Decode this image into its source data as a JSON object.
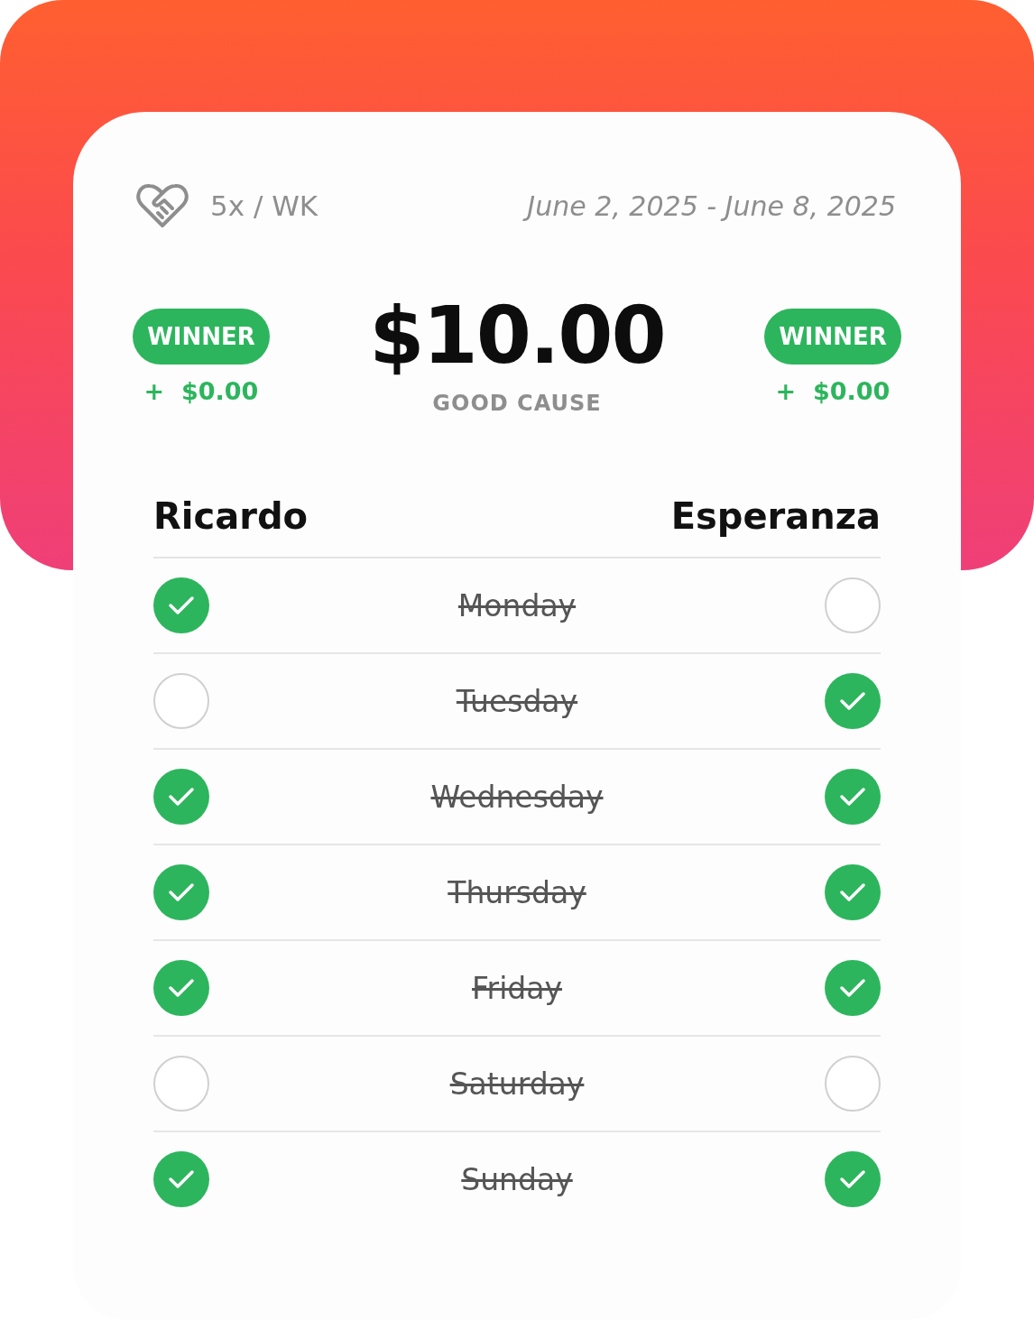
{
  "header": {
    "frequency": "5x / WK",
    "date_range": "June 2, 2025 - June 8, 2025"
  },
  "pot": {
    "amount": "$10.00",
    "label": "GOOD CAUSE"
  },
  "players": [
    {
      "name": "Ricardo",
      "badge": "WINNER",
      "bonus": "+  $0.00"
    },
    {
      "name": "Esperanza",
      "badge": "WINNER",
      "bonus": "+  $0.00"
    }
  ],
  "days": [
    {
      "day": "Monday",
      "struck": true,
      "left_checked": true,
      "right_checked": false
    },
    {
      "day": "Tuesday",
      "struck": true,
      "left_checked": false,
      "right_checked": true
    },
    {
      "day": "Wednesday",
      "struck": true,
      "left_checked": true,
      "right_checked": true
    },
    {
      "day": "Thursday",
      "struck": true,
      "left_checked": true,
      "right_checked": true
    },
    {
      "day": "Friday",
      "struck": true,
      "left_checked": true,
      "right_checked": true
    },
    {
      "day": "Saturday",
      "struck": true,
      "left_checked": false,
      "right_checked": false
    },
    {
      "day": "Sunday",
      "struck": true,
      "left_checked": true,
      "right_checked": true
    }
  ]
}
